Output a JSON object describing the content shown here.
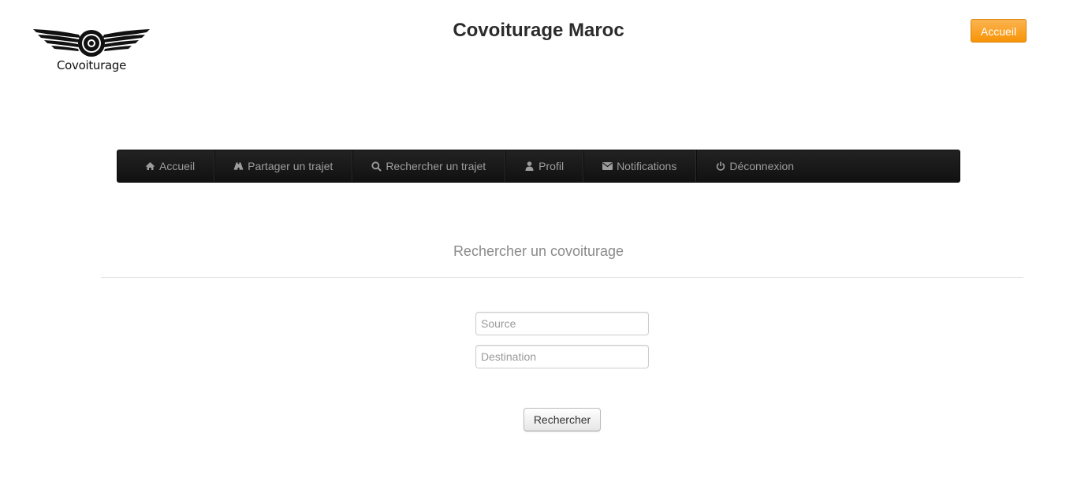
{
  "brand": {
    "logo_text": "Covoiturage",
    "icon": "winged-wheel-logo"
  },
  "header": {
    "title": "Covoiturage Maroc",
    "home_button": "Accueil"
  },
  "colors": {
    "accent": "#f89406",
    "navbar": "#1b1b1b"
  },
  "nav": {
    "items": [
      {
        "label": "Accueil",
        "icon": "home-icon"
      },
      {
        "label": "Partager un trajet",
        "icon": "road-icon"
      },
      {
        "label": "Rechercher un trajet",
        "icon": "search-icon"
      },
      {
        "label": "Profil",
        "icon": "user-icon"
      },
      {
        "label": "Notifications",
        "icon": "envelope-icon"
      },
      {
        "label": "Déconnexion",
        "icon": "power-icon"
      }
    ]
  },
  "search": {
    "title": "Rechercher un covoiturage",
    "source_placeholder": "Source",
    "source_value": "",
    "destination_placeholder": "Destination",
    "destination_value": "",
    "submit_label": "Rechercher"
  }
}
